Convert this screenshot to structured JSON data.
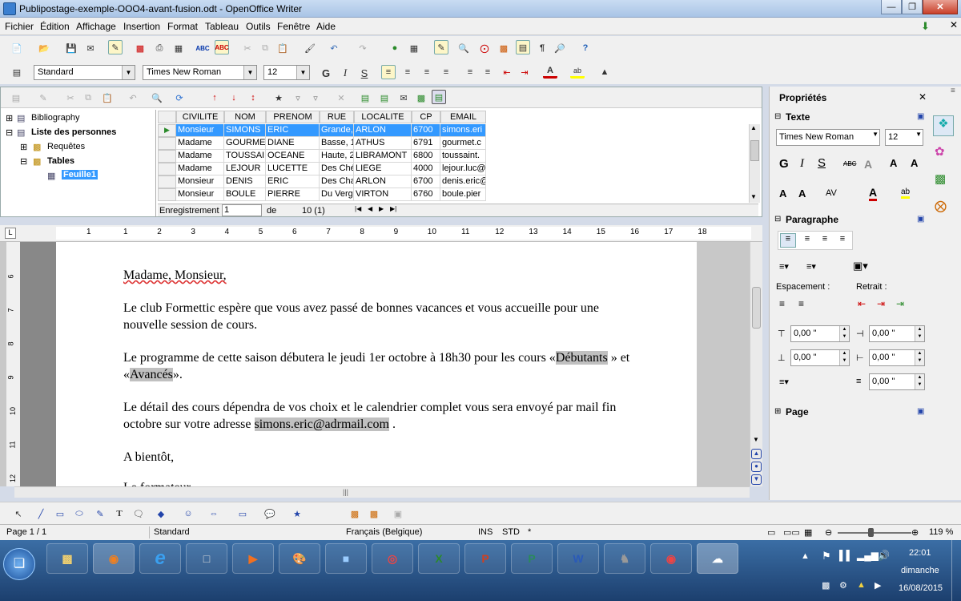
{
  "window": {
    "title": "Publipostage-exemple-OOO4-avant-fusion.odt - OpenOffice Writer"
  },
  "menu": [
    "Fichier",
    "Édition",
    "Affichage",
    "Insertion",
    "Format",
    "Tableau",
    "Outils",
    "Fenêtre",
    "Aide"
  ],
  "format_bar": {
    "style": "Standard",
    "font": "Times New Roman",
    "size": "12"
  },
  "datasources": {
    "tree": [
      "Bibliography",
      "Liste des personnes",
      "Requêtes",
      "Tables",
      "Feuille1"
    ]
  },
  "grid": {
    "columns": [
      "CIVILITE",
      "NOM",
      "PRENOM",
      "RUE",
      "LOCALITE",
      "CP",
      "EMAIL"
    ],
    "rows": [
      [
        "Monsieur",
        "SIMONS",
        "ERIC",
        "Grande, 1",
        "ARLON",
        "6700",
        "simons.eri"
      ],
      [
        "Madame",
        "GOURME",
        "DIANE",
        "Basse, 1",
        "ATHUS",
        "6791",
        "gourmet.c"
      ],
      [
        "Madame",
        "TOUSSAI",
        "OCEANE",
        "Haute, 2",
        "LIBRAMONT",
        "6800",
        "toussaint."
      ],
      [
        "Madame",
        "LEJOUR",
        "LUCETTE",
        "Des Ché",
        "LIEGE",
        "4000",
        "lejour.luc@"
      ],
      [
        "Monsieur",
        "DENIS",
        "ERIC",
        "Des Cha",
        "ARLON",
        "6700",
        "denis.eric@"
      ],
      [
        "Monsieur",
        "BOULE",
        "PIERRE",
        "Du Verg",
        "VIRTON",
        "6760",
        "boule.pier"
      ]
    ],
    "record_label": "Enregistrement",
    "record_value": "1",
    "of_label": "de",
    "total": "10 (1)"
  },
  "ruler": {
    "marks": [
      "1",
      "1",
      "2",
      "3",
      "4",
      "5",
      "6",
      "7",
      "8",
      "9",
      "10",
      "11",
      "12",
      "13",
      "14",
      "15",
      "16",
      "17",
      "18"
    ],
    "vmarks": [
      "6",
      "7",
      "8",
      "9",
      "10",
      "11",
      "12"
    ]
  },
  "document": {
    "salutation": "Madame, Monsieur,",
    "p1a": "Le club Formettic espère que vous avez passé de bonnes vacances et vous accueille pour une",
    "p1b": "nouvelle session de cours.",
    "p2a": "Le programme de cette saison débutera le jeudi 1er octobre à 18h30 pour les cours «",
    "p2_f1": "Débutants",
    "p2_mid": "» et",
    "p2b_open": "«",
    "p2_f2": "Avancés",
    "p2b_close": "».",
    "p3a": "Le détail des cours dépendra de vos choix et le calendrier complet vous sera envoyé par mail fin",
    "p3b_pre": "octobre sur votre adresse",
    "p3_field": "simons.eric@adrmail.com",
    "p3b_post": ".",
    "closing": "A bientôt,",
    "sign": "Le formateur"
  },
  "sidebar": {
    "title": "Propriétés",
    "texte": "Texte",
    "font": "Times New Roman",
    "size": "12",
    "paragraphe": "Paragraphe",
    "espacement": "Espacement :",
    "retrait": "Retrait :",
    "v1": "0,00 \"",
    "v2": "0,00 \"",
    "v3": "0,00 \"",
    "v4": "0,00 \"",
    "v5": "0,00 \"",
    "page": "Page"
  },
  "status": {
    "page": "Page 1 / 1",
    "style": "Standard",
    "lang": "Français (Belgique)",
    "ins": "INS",
    "std": "STD",
    "star": "*",
    "zoom": "119 %"
  },
  "taskbar": {
    "time": "22:01",
    "day": "dimanche",
    "date": "16/08/2015"
  },
  "colors": {
    "accent": "#3399ff",
    "font_color": "#cc0000",
    "highlight": "#ffff00"
  }
}
